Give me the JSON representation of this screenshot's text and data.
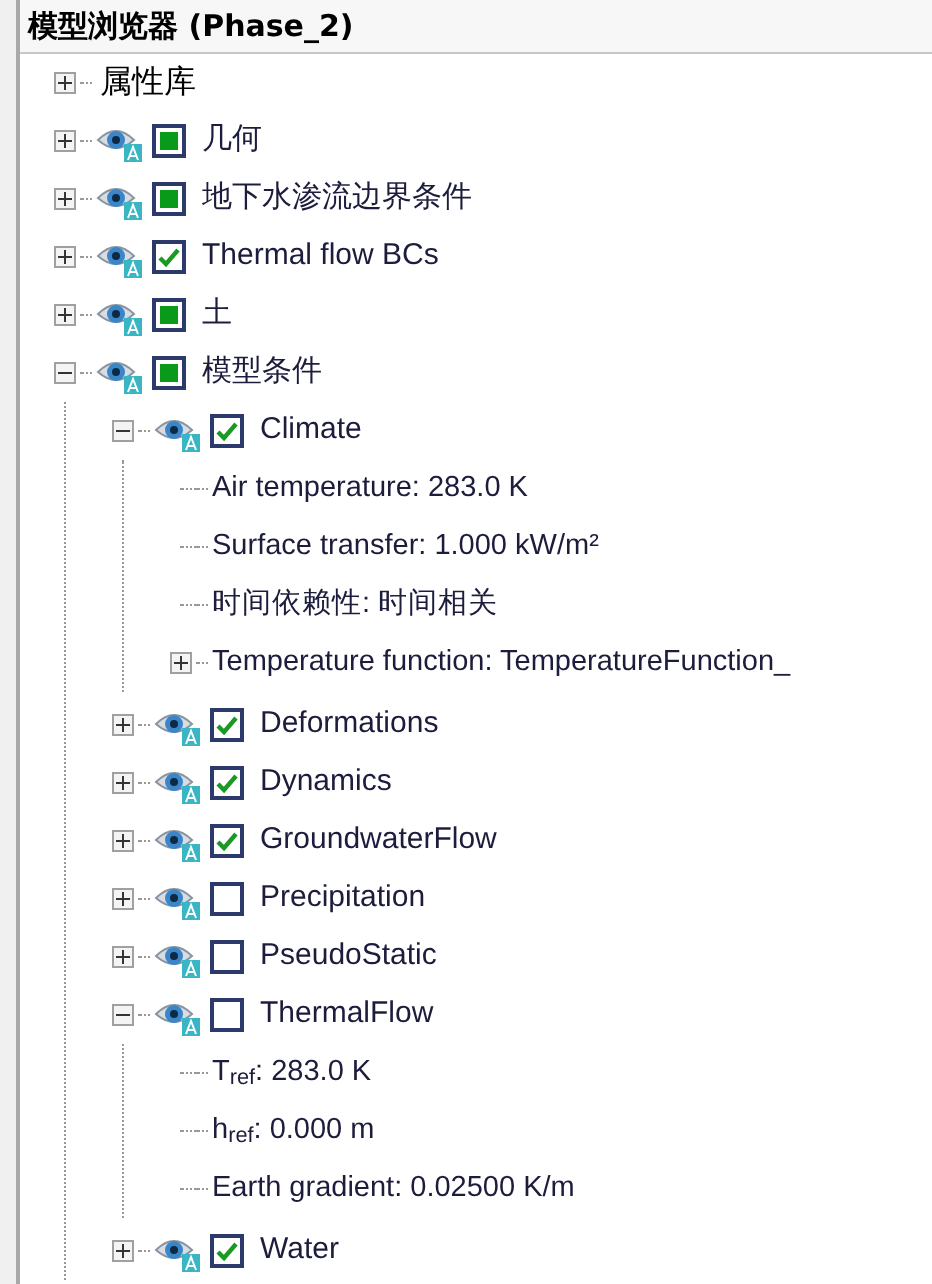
{
  "title": "模型浏览器 (Phase_2)",
  "tree": [
    {
      "kind": "folder",
      "label": "属性库",
      "expanded": false
    },
    {
      "kind": "layer",
      "label": "几何",
      "expanded": false,
      "checked": false,
      "mixed": true
    },
    {
      "kind": "layer",
      "label": "地下水渗流边界条件",
      "expanded": false,
      "checked": false,
      "mixed": true
    },
    {
      "kind": "layer",
      "label": "Thermal flow BCs",
      "expanded": false,
      "checked": true,
      "mixed": false
    },
    {
      "kind": "layer",
      "label": "土",
      "expanded": false,
      "checked": false,
      "mixed": true
    },
    {
      "kind": "layer",
      "label": "模型条件",
      "expanded": true,
      "checked": false,
      "mixed": true,
      "children": [
        {
          "kind": "layer",
          "label": "Climate",
          "expanded": true,
          "checked": true,
          "mixed": false,
          "children": [
            {
              "kind": "property",
              "label": "Air temperature: 283.0 K"
            },
            {
              "kind": "property",
              "label": "Surface transfer: 1.000 kW/m²"
            },
            {
              "kind": "property",
              "label": "时间依赖性: 时间相关"
            },
            {
              "kind": "property",
              "label": "Temperature function: TemperatureFunction_",
              "expanded": false
            }
          ]
        },
        {
          "kind": "layer",
          "label": "Deformations",
          "expanded": false,
          "checked": true,
          "mixed": false
        },
        {
          "kind": "layer",
          "label": "Dynamics",
          "expanded": false,
          "checked": true,
          "mixed": false
        },
        {
          "kind": "layer",
          "label": "GroundwaterFlow",
          "expanded": false,
          "checked": true,
          "mixed": false
        },
        {
          "kind": "layer",
          "label": "Precipitation",
          "expanded": false,
          "checked": false,
          "mixed": false
        },
        {
          "kind": "layer",
          "label": "PseudoStatic",
          "expanded": false,
          "checked": false,
          "mixed": false
        },
        {
          "kind": "layer",
          "label": "ThermalFlow",
          "expanded": true,
          "checked": false,
          "mixed": false,
          "children": [
            {
              "kind": "property",
              "label": "T$_{ref}$: 283.0 K"
            },
            {
              "kind": "property",
              "label": "h$_{ref}$: 0.000 m"
            },
            {
              "kind": "property",
              "label": "Earth gradient: 0.02500 K/m"
            }
          ]
        },
        {
          "kind": "layer",
          "label": "Water",
          "expanded": false,
          "checked": true,
          "mixed": false
        }
      ]
    }
  ]
}
